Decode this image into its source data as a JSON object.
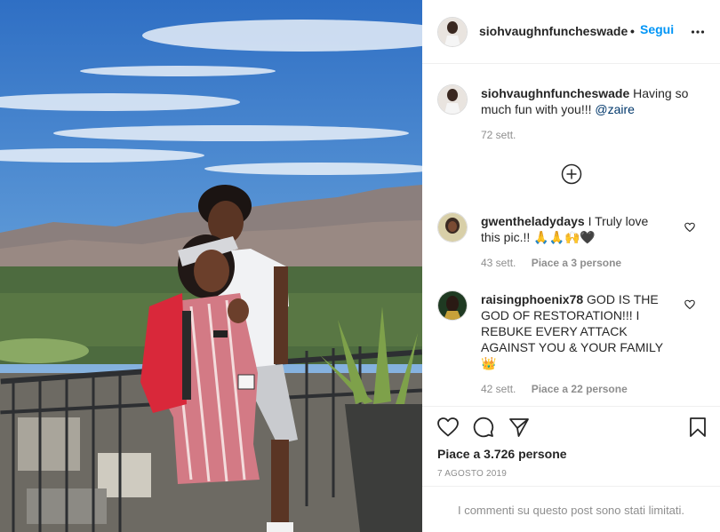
{
  "header": {
    "username": "siohvaughnfuncheswade",
    "dot": "•",
    "follow_label": "Segui",
    "more_icon": "more-icon"
  },
  "caption": {
    "username": "siohvaughnfuncheswade",
    "text_line1": "Having so",
    "text_line2": "much fun with you!!!",
    "mention": "@zaire",
    "time": "72 sett."
  },
  "load_more_icon": "plus-circle-icon",
  "comments": [
    {
      "username": "gwentheladydays",
      "line1": "I Truly love",
      "line2": "this pic.!! 🙏🙏🙌🖤",
      "time": "43 sett.",
      "likes": "Piace a 3 persone"
    },
    {
      "username": "raisingphoenix78",
      "line1": "GOD IS THE",
      "line2": "GOD OF RESTORATION!!! I",
      "line3": "REBUKE EVERY ATTACK",
      "line4": "AGAINST YOU & YOUR FAMILY",
      "line5": "👑",
      "time": "42 sett.",
      "likes": "Piace a 22 persone"
    }
  ],
  "actions": {
    "likes": "Piace a 3.726 persone",
    "date": "7 AGOSTO 2019"
  },
  "footer": {
    "limited_text": "I commenti su questo post sono stati limitati."
  },
  "colors": {
    "follow": "#0095f6",
    "secondary": "#8e8e8e",
    "border": "#efefef"
  }
}
